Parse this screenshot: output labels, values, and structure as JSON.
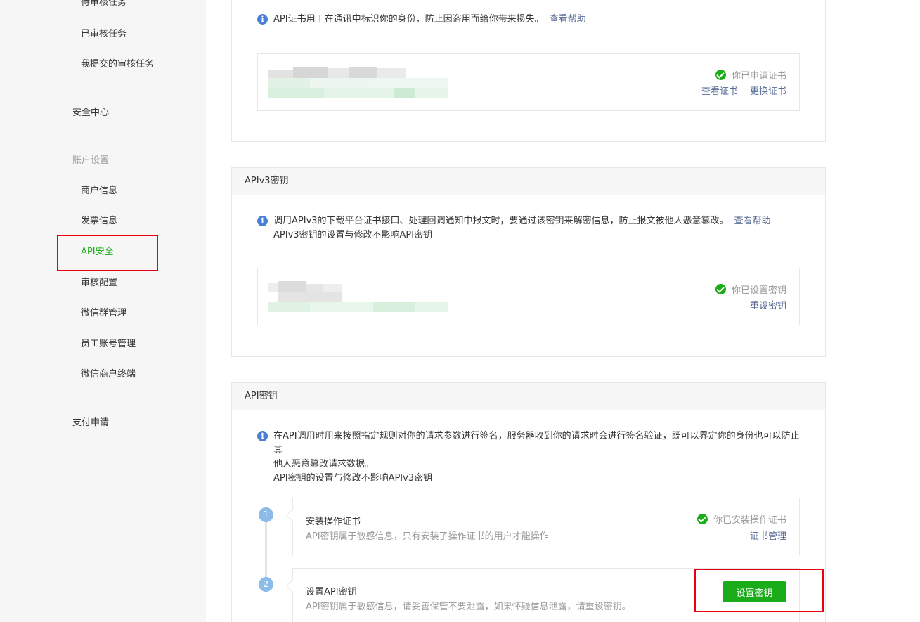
{
  "sidebar": {
    "items_top": [
      {
        "label": "待审核任务"
      },
      {
        "label": "已审核任务"
      },
      {
        "label": "我提交的审核任务"
      }
    ],
    "security_center": "安全中心",
    "account_settings": "账户设置",
    "items_account": [
      {
        "label": "商户信息"
      },
      {
        "label": "发票信息"
      },
      {
        "label": "API安全"
      },
      {
        "label": "审核配置"
      },
      {
        "label": "微信群管理"
      },
      {
        "label": "员工账号管理"
      },
      {
        "label": "微信商户终端"
      }
    ],
    "pay_apply": "支付申请",
    "active_color": "#1aad19"
  },
  "cert_panel": {
    "info": "API证书用于在通讯中标识你的身份，防止因盗用而给你带来损失。",
    "help_link": "查看帮助",
    "status": "你已申请证书",
    "view_cert": "查看证书",
    "replace_cert": "更换证书"
  },
  "apiv3_panel": {
    "title": "APIv3密钥",
    "info_line1": "调用APIv3的下载平台证书接口、处理回调通知中报文时，要通过该密钥来解密信息，防止报文被他人恶意篡改。",
    "help_link": "查看帮助",
    "info_line2": "APIv3密钥的设置与修改不影响API密钥",
    "status": "你已设置密钥",
    "reset_key": "重设密钥"
  },
  "api_key_panel": {
    "title": "API密钥",
    "info_line1": "在API调用时用来按照指定规则对你的请求参数进行签名，服务器收到你的请求时会进行签名验证，既可以界定你的身份也可以防止其",
    "info_line2": "他人恶意篡改请求数据。",
    "info_line3": "API密钥的设置与修改不影响APIv3密钥",
    "steps": [
      {
        "num": "1",
        "title": "安装操作证书",
        "desc": "API密钥属于敏感信息，只有安装了操作证书的用户才能操作",
        "status": "你已安装操作证书",
        "action": "证书管理"
      },
      {
        "num": "2",
        "title": "设置API密钥",
        "desc": "API密钥属于敏感信息，请妥善保管不要泄露，如果怀疑信息泄露，请重设密钥。",
        "button": "设置密钥"
      }
    ]
  },
  "colors": {
    "accent_green": "#1aad19",
    "link_blue": "#576b95",
    "highlight_red": "#e60012"
  }
}
